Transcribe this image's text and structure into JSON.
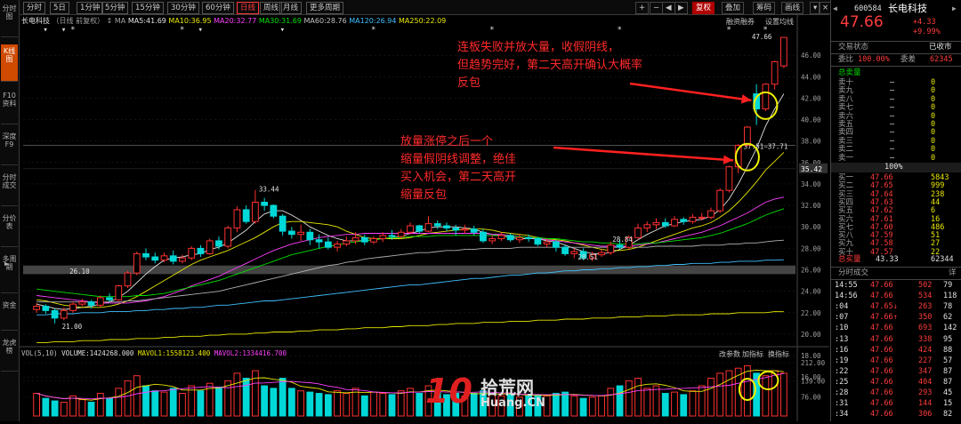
{
  "left_toolbar": [
    {
      "label": "分时图"
    },
    {
      "label": "K线图"
    },
    {
      "label": "F10资料"
    },
    {
      "label": "深度F9"
    },
    {
      "label": "分时成交"
    },
    {
      "label": "分价表"
    },
    {
      "label": "多周期"
    },
    {
      "label": "资金"
    },
    {
      "label": "龙虎榜"
    }
  ],
  "period_tabs": [
    "分时",
    "5日",
    "1分钟",
    "5分钟",
    "15分钟",
    "30分钟",
    "60分钟",
    "日线",
    "周线",
    "月线",
    "更多周期"
  ],
  "active_period": "日线",
  "toolbar_right": {
    "plus": "+",
    "minus": "−",
    "left": "◀",
    "right": "▶",
    "fq": "复权",
    "stack": "叠加",
    "chip": "筹码",
    "draw": "画线",
    "close": "×",
    "dropdown": "▾"
  },
  "chart_header": {
    "stock_name": "长电科技",
    "mode": "（日线 前复权）",
    "arrows": "↕",
    "ma_label": "MA",
    "ma5": "MA5:41.69",
    "ma10": "MA10:36.95",
    "ma20": "MA20:32.77",
    "ma30": "MA30:31.69",
    "ma60": "MA60:28.76",
    "ma120": "MA120:26.94",
    "ma250": "MA250:22.09",
    "fusion": "融资融券",
    "settings": "设置均线"
  },
  "annotations": {
    "note1": [
      "连板失败并放大量，收假阴线，",
      "但趋势完好，第二天高开确认大概率",
      "反包"
    ],
    "note2": [
      "放量涨停之后一个",
      "缩量假阴线调整，绝佳",
      "买入机会，第二天高开",
      "缩量反包"
    ]
  },
  "price_labels": {
    "high": "47.66",
    "p3344": "33.44",
    "p2100": "21.00",
    "p2851": "28.51",
    "p2610": "26.10",
    "range": "37.51−37.71",
    "p2884": "28.84"
  },
  "volume_header": {
    "vol": "VOL(5,10)",
    "volume": "VOLUME:1424268.000",
    "mavol1": "MAVOL1:1558123.400",
    "mavol2": "MAVOL2:1334416.700",
    "tabs": [
      "改参数",
      "加指标",
      "换指标"
    ]
  },
  "y_axis": [
    "46.00",
    "44.00",
    "42.00",
    "40.00",
    "38.00",
    "36.00",
    "35.42",
    "34.00",
    "32.00",
    "30.00",
    "28.00",
    "26.00",
    "24.00",
    "22.00",
    "20.00",
    "18.00",
    "16.00"
  ],
  "vol_axis": [
    "212.00",
    "139.00",
    "76.00"
  ],
  "watermark": {
    "ten": "10",
    "brand": "拾荒网",
    "url": "Huang.CN"
  },
  "quote": {
    "code": "600584",
    "name": "长电科技",
    "price": "47.66",
    "change": "+4.33",
    "pct": "+9.99%",
    "status_label": "交易状态",
    "status": "已收市",
    "weibi_label": "委比",
    "weibi": "100.00%",
    "weicha_label": "委差",
    "weicha": "62345",
    "sell_total_label": "总卖量",
    "sells": [
      {
        "l": "卖十",
        "p": "—",
        "v": "0"
      },
      {
        "l": "卖九",
        "p": "—",
        "v": "0"
      },
      {
        "l": "卖八",
        "p": "—",
        "v": "0"
      },
      {
        "l": "卖七",
        "p": "—",
        "v": "0"
      },
      {
        "l": "卖六",
        "p": "—",
        "v": "0"
      },
      {
        "l": "卖五",
        "p": "—",
        "v": "0"
      },
      {
        "l": "卖四",
        "p": "—",
        "v": "0"
      },
      {
        "l": "卖三",
        "p": "—",
        "v": "0"
      },
      {
        "l": "卖二",
        "p": "—",
        "v": "0"
      },
      {
        "l": "卖一",
        "p": "—",
        "v": "0"
      }
    ],
    "ratio": "100%",
    "buys": [
      {
        "l": "买一",
        "p": "47.66",
        "v": "5843"
      },
      {
        "l": "买二",
        "p": "47.65",
        "v": "999"
      },
      {
        "l": "买三",
        "p": "47.64",
        "v": "238"
      },
      {
        "l": "买四",
        "p": "47.63",
        "v": "44"
      },
      {
        "l": "买五",
        "p": "47.62",
        "v": "6"
      },
      {
        "l": "买六",
        "p": "47.61",
        "v": "16"
      },
      {
        "l": "买七",
        "p": "47.60",
        "v": "486"
      },
      {
        "l": "买八",
        "p": "47.59",
        "v": "51"
      },
      {
        "l": "买九",
        "p": "47.58",
        "v": "27"
      },
      {
        "l": "买十",
        "p": "47.57",
        "v": "22"
      }
    ],
    "buy_total_label": "总买量",
    "buy_total_avg": "43.33",
    "buy_total": "62344"
  },
  "trades": {
    "title": "分时成交",
    "detail": "详",
    "rows": [
      {
        "t": "14:55",
        "p": "47.66",
        "v": "502",
        "n": "79"
      },
      {
        "t": "14:56",
        "p": "47.66",
        "v": "534",
        "n": "118"
      },
      {
        "t": ":04",
        "p": "47.65↓",
        "v": "263",
        "n": "78"
      },
      {
        "t": ":07",
        "p": "47.66↑",
        "v": "350",
        "n": "62"
      },
      {
        "t": ":10",
        "p": "47.66",
        "v": "693",
        "n": "142"
      },
      {
        "t": ":13",
        "p": "47.66",
        "v": "338",
        "n": "95"
      },
      {
        "t": ":16",
        "p": "47.66",
        "v": "424",
        "n": "88"
      },
      {
        "t": ":19",
        "p": "47.66",
        "v": "227",
        "n": "57"
      },
      {
        "t": ":22",
        "p": "47.66",
        "v": "347",
        "n": "87"
      },
      {
        "t": ":25",
        "p": "47.66",
        "v": "404",
        "n": "87"
      },
      {
        "t": ":28",
        "p": "47.66",
        "v": "293",
        "n": "45"
      },
      {
        "t": ":31",
        "p": "47.66",
        "v": "144",
        "n": "15"
      },
      {
        "t": ":34",
        "p": "47.66",
        "v": "306",
        "n": "82"
      }
    ]
  },
  "chart_data": {
    "type": "candlestick",
    "ylim": [
      19,
      48
    ],
    "candles": [
      [
        22.3,
        22.6,
        22.0,
        22.9
      ],
      [
        22.6,
        22.2,
        21.9,
        22.8
      ],
      [
        22.2,
        21.5,
        21.0,
        22.4
      ],
      [
        21.5,
        22.2,
        21.3,
        22.5
      ],
      [
        22.2,
        22.8,
        22.0,
        23.0
      ],
      [
        22.8,
        23.0,
        22.6,
        23.3
      ],
      [
        23.0,
        22.7,
        22.4,
        23.2
      ],
      [
        22.7,
        23.4,
        22.5,
        23.6
      ],
      [
        23.4,
        23.2,
        23.0,
        23.8
      ],
      [
        23.2,
        24.5,
        23.1,
        24.6
      ],
      [
        24.5,
        25.7,
        24.3,
        25.9
      ],
      [
        25.7,
        27.5,
        25.5,
        27.7
      ],
      [
        27.5,
        27.2,
        26.9,
        28.0
      ],
      [
        27.2,
        26.9,
        26.6,
        27.6
      ],
      [
        26.9,
        27.3,
        26.7,
        27.6
      ],
      [
        27.3,
        26.8,
        26.5,
        27.8
      ],
      [
        26.8,
        27.1,
        26.6,
        27.4
      ],
      [
        27.1,
        28.0,
        26.9,
        28.2
      ],
      [
        28.0,
        27.5,
        27.2,
        28.3
      ],
      [
        27.5,
        28.7,
        27.4,
        28.9
      ],
      [
        28.7,
        28.2,
        27.9,
        29.1
      ],
      [
        28.2,
        29.9,
        28.0,
        30.1
      ],
      [
        29.9,
        31.6,
        29.5,
        31.9
      ],
      [
        31.6,
        30.5,
        30.3,
        32.0
      ],
      [
        30.5,
        32.3,
        30.3,
        33.44
      ],
      [
        32.3,
        32.0,
        31.5,
        32.7
      ],
      [
        32.0,
        31.0,
        30.8,
        32.1
      ],
      [
        31.0,
        29.6,
        29.2,
        31.2
      ],
      [
        29.6,
        29.3,
        28.9,
        30.0
      ],
      [
        29.3,
        29.5,
        28.7,
        30.2
      ],
      [
        29.5,
        28.8,
        28.3,
        29.8
      ],
      [
        28.8,
        28.6,
        28.0,
        29.3
      ],
      [
        28.6,
        28.1,
        27.9,
        29.0
      ],
      [
        28.1,
        28.4,
        27.7,
        28.7
      ],
      [
        28.4,
        28.7,
        28.2,
        29.1
      ],
      [
        28.7,
        29.0,
        28.4,
        29.5
      ],
      [
        29.0,
        28.6,
        28.3,
        29.3
      ],
      [
        28.6,
        28.9,
        28.4,
        29.1
      ],
      [
        28.9,
        29.2,
        28.6,
        29.5
      ],
      [
        29.2,
        29.1,
        28.8,
        29.7
      ],
      [
        29.1,
        29.5,
        28.9,
        29.8
      ],
      [
        29.5,
        30.1,
        29.3,
        30.4
      ],
      [
        30.1,
        29.6,
        29.4,
        30.2
      ],
      [
        29.6,
        30.3,
        29.5,
        31.0
      ],
      [
        30.3,
        30.1,
        29.8,
        30.6
      ],
      [
        30.1,
        29.9,
        29.6,
        30.4
      ],
      [
        29.9,
        29.7,
        29.2,
        30.2
      ],
      [
        29.7,
        29.8,
        29.4,
        30.2
      ],
      [
        29.8,
        29.5,
        29.2,
        30.1
      ],
      [
        29.5,
        28.7,
        28.5,
        29.8
      ],
      [
        28.7,
        28.9,
        28.4,
        29.2
      ],
      [
        28.9,
        29.2,
        28.7,
        29.5
      ],
      [
        29.2,
        28.8,
        28.6,
        29.4
      ],
      [
        28.8,
        29.0,
        28.5,
        29.3
      ],
      [
        29.0,
        28.9,
        28.6,
        29.3
      ],
      [
        28.9,
        28.4,
        28.2,
        29.1
      ],
      [
        28.4,
        28.6,
        28.1,
        28.9
      ],
      [
        28.6,
        28.1,
        27.7,
        28.8
      ],
      [
        28.1,
        27.5,
        27.3,
        28.3
      ],
      [
        27.5,
        27.7,
        27.1,
        28.0
      ],
      [
        27.7,
        27.1,
        26.9,
        28.0
      ],
      [
        27.1,
        27.4,
        26.8,
        27.7
      ],
      [
        27.4,
        27.6,
        27.2,
        27.9
      ],
      [
        27.6,
        28.3,
        27.4,
        28.6
      ],
      [
        28.3,
        28.1,
        27.9,
        28.84
      ],
      [
        28.1,
        29.0,
        27.9,
        29.2
      ],
      [
        29.0,
        29.9,
        28.9,
        30.3
      ],
      [
        29.9,
        30.2,
        29.5,
        30.5
      ],
      [
        30.2,
        30.4,
        29.8,
        30.8
      ],
      [
        30.4,
        30.1,
        29.9,
        30.8
      ],
      [
        30.1,
        30.7,
        30.0,
        31.0
      ],
      [
        30.7,
        30.5,
        30.2,
        30.9
      ],
      [
        30.5,
        30.9,
        30.3,
        31.2
      ],
      [
        30.9,
        30.9,
        30.6,
        31.3
      ],
      [
        30.9,
        31.5,
        30.7,
        31.8
      ],
      [
        31.5,
        33.4,
        31.3,
        33.6
      ],
      [
        33.4,
        35.6,
        33.2,
        35.7
      ],
      [
        35.6,
        37.6,
        35.0,
        37.71
      ],
      [
        37.6,
        39.3,
        37.5,
        39.4
      ],
      [
        42.4,
        41.0,
        39.5,
        43.3
      ],
      [
        41.0,
        43.3,
        40.8,
        43.4
      ],
      [
        43.3,
        45.4,
        42.8,
        45.5
      ],
      [
        45.0,
        47.66,
        44.8,
        47.66
      ]
    ],
    "volumes": [
      90,
      70,
      60,
      55,
      80,
      65,
      55,
      90,
      70,
      110,
      140,
      160,
      120,
      100,
      95,
      110,
      90,
      120,
      100,
      130,
      115,
      140,
      170,
      150,
      180,
      120,
      110,
      150,
      110,
      100,
      95,
      90,
      85,
      100,
      90,
      110,
      80,
      95,
      90,
      85,
      100,
      110,
      90,
      120,
      95,
      85,
      90,
      80,
      90,
      100,
      85,
      80,
      90,
      75,
      80,
      85,
      80,
      90,
      95,
      80,
      70,
      75,
      80,
      110,
      120,
      140,
      150,
      110,
      120,
      90,
      95,
      85,
      100,
      120,
      150,
      170,
      180,
      190,
      200,
      170,
      160,
      180,
      170
    ],
    "ma5": [
      22.8,
      22.6,
      22.4,
      22.3,
      22.4,
      22.5,
      22.6,
      22.8,
      23.0,
      23.4,
      24.0,
      24.8,
      25.6,
      26.3,
      26.9,
      27.1,
      27.2,
      27.4,
      27.5,
      27.9,
      28.1,
      28.5,
      29.1,
      29.7,
      30.5,
      31.2,
      31.5,
      31.5,
      31.1,
      30.6,
      30.0,
      29.6,
      29.2,
      28.9,
      28.7,
      28.7,
      28.7,
      28.8,
      28.9,
      29.0,
      29.1,
      29.4,
      29.6,
      29.9,
      30.0,
      30.0,
      30.0,
      29.9,
      29.8,
      29.5,
      29.3,
      29.2,
      29.0,
      28.9,
      28.9,
      28.9,
      28.7,
      28.6,
      28.3,
      28.0,
      27.7,
      27.5,
      27.5,
      27.6,
      27.9,
      28.3,
      28.8,
      29.3,
      29.7,
      30.1,
      30.3,
      30.5,
      30.6,
      30.7,
      31.0,
      31.6,
      32.6,
      34.0,
      35.6,
      37.3,
      39.4,
      41.0,
      42.4
    ],
    "ma10": [
      23.2,
      23.1,
      22.9,
      22.7,
      22.6,
      22.5,
      22.5,
      22.5,
      22.6,
      22.8,
      23.1,
      23.5,
      24.0,
      24.5,
      25.0,
      25.5,
      26.0,
      26.5,
      26.9,
      27.2,
      27.5,
      27.8,
      28.2,
      28.6,
      29.0,
      29.5,
      30.0,
      30.4,
      30.5,
      30.5,
      30.4,
      30.3,
      30.2,
      30.0,
      29.6,
      29.3,
      29.0,
      28.9,
      28.9,
      28.9,
      28.9,
      29.0,
      29.2,
      29.4,
      29.5,
      29.6,
      29.7,
      29.8,
      29.8,
      29.8,
      29.7,
      29.5,
      29.4,
      29.3,
      29.2,
      29.0,
      28.9,
      28.8,
      28.7,
      28.5,
      28.3,
      28.1,
      27.9,
      27.8,
      27.8,
      27.9,
      28.1,
      28.4,
      28.7,
      29.0,
      29.3,
      29.6,
      29.9,
      30.1,
      30.4,
      30.9,
      31.5,
      32.3,
      33.2,
      34.2,
      35.3,
      36.1,
      36.95
    ],
    "ma20": [
      23.6,
      23.5,
      23.4,
      23.3,
      23.2,
      23.1,
      23.0,
      22.9,
      22.9,
      22.9,
      22.9,
      23.0,
      23.1,
      23.3,
      23.5,
      23.8,
      24.1,
      24.5,
      24.8,
      25.1,
      25.4,
      25.8,
      26.2,
      26.6,
      27.0,
      27.4,
      27.8,
      28.1,
      28.4,
      28.6,
      28.8,
      29.0,
      29.1,
      29.2,
      29.3,
      29.3,
      29.4,
      29.4,
      29.4,
      29.4,
      29.4,
      29.4,
      29.4,
      29.4,
      29.4,
      29.4,
      29.4,
      29.4,
      29.4,
      29.4,
      29.3,
      29.3,
      29.2,
      29.1,
      29.0,
      28.9,
      28.8,
      28.7,
      28.6,
      28.5,
      28.4,
      28.3,
      28.2,
      28.2,
      28.2,
      28.2,
      28.3,
      28.4,
      28.5,
      28.7,
      28.9,
      29.1,
      29.3,
      29.5,
      29.8,
      30.1,
      30.5,
      30.9,
      31.3,
      31.8,
      32.3,
      32.6,
      32.77
    ],
    "ma30": [
      24.2,
      24.1,
      24.0,
      23.9,
      23.8,
      23.7,
      23.6,
      23.5,
      23.5,
      23.5,
      23.5,
      23.6,
      23.6,
      23.7,
      23.8,
      24.0,
      24.2,
      24.4,
      24.6,
      24.8,
      25.0,
      25.3,
      25.6,
      25.9,
      26.2,
      26.5,
      26.8,
      27.1,
      27.4,
      27.6,
      27.8,
      28.0,
      28.2,
      28.3,
      28.5,
      28.6,
      28.7,
      28.8,
      28.9,
      29.0,
      29.0,
      29.1,
      29.1,
      29.1,
      29.2,
      29.2,
      29.2,
      29.2,
      29.2,
      29.2,
      29.2,
      29.2,
      29.1,
      29.1,
      29.0,
      29.0,
      28.9,
      28.9,
      28.8,
      28.7,
      28.6,
      28.6,
      28.5,
      28.5,
      28.4,
      28.4,
      28.4,
      28.5,
      28.5,
      28.6,
      28.7,
      28.8,
      28.9,
      29.0,
      29.2,
      29.4,
      29.7,
      30.0,
      30.3,
      30.7,
      31.1,
      31.4,
      31.69
    ],
    "ma60": [
      23.0,
      23.0,
      23.0,
      23.0,
      23.0,
      23.0,
      23.0,
      23.0,
      23.0,
      23.0,
      23.1,
      23.1,
      23.2,
      23.3,
      23.4,
      23.5,
      23.6,
      23.7,
      23.8,
      23.9,
      24.0,
      24.2,
      24.4,
      24.6,
      24.8,
      25.0,
      25.2,
      25.4,
      25.6,
      25.8,
      26.0,
      26.2,
      26.4,
      26.5,
      26.7,
      26.8,
      27.0,
      27.1,
      27.2,
      27.3,
      27.4,
      27.5,
      27.6,
      27.6,
      27.7,
      27.8,
      27.8,
      27.9,
      27.9,
      28.0,
      28.0,
      28.0,
      28.0,
      28.1,
      28.1,
      28.1,
      28.1,
      28.1,
      28.1,
      28.1,
      28.1,
      28.1,
      28.1,
      28.1,
      28.1,
      28.1,
      28.1,
      28.1,
      28.2,
      28.2,
      28.2,
      28.2,
      28.2,
      28.3,
      28.3,
      28.3,
      28.4,
      28.4,
      28.5,
      28.5,
      28.6,
      28.7,
      28.76
    ],
    "ma120": [
      21.8,
      21.8,
      21.9,
      21.9,
      21.9,
      22.0,
      22.0,
      22.0,
      22.1,
      22.1,
      22.1,
      22.2,
      22.2,
      22.3,
      22.3,
      22.4,
      22.4,
      22.5,
      22.5,
      22.6,
      22.7,
      22.7,
      22.8,
      22.9,
      23.0,
      23.1,
      23.1,
      23.2,
      23.3,
      23.4,
      23.5,
      23.6,
      23.7,
      23.8,
      23.9,
      24.0,
      24.1,
      24.2,
      24.3,
      24.4,
      24.5,
      24.6,
      24.6,
      24.7,
      24.8,
      24.9,
      25.0,
      25.1,
      25.2,
      25.2,
      25.3,
      25.4,
      25.5,
      25.5,
      25.6,
      25.7,
      25.7,
      25.8,
      25.9,
      25.9,
      26.0,
      26.0,
      26.1,
      26.1,
      26.2,
      26.2,
      26.3,
      26.3,
      26.4,
      26.4,
      26.5,
      26.5,
      26.6,
      26.6,
      26.6,
      26.7,
      26.7,
      26.8,
      26.8,
      26.8,
      26.9,
      26.9,
      26.94
    ],
    "ma250": [
      19.2,
      19.2,
      19.3,
      19.3,
      19.3,
      19.4,
      19.4,
      19.4,
      19.5,
      19.5,
      19.5,
      19.6,
      19.6,
      19.6,
      19.7,
      19.7,
      19.8,
      19.8,
      19.8,
      19.9,
      19.9,
      20.0,
      20.0,
      20.0,
      20.1,
      20.1,
      20.2,
      20.2,
      20.2,
      20.3,
      20.3,
      20.4,
      20.4,
      20.4,
      20.5,
      20.5,
      20.6,
      20.6,
      20.6,
      20.7,
      20.7,
      20.8,
      20.8,
      20.8,
      20.9,
      20.9,
      21.0,
      21.0,
      21.0,
      21.1,
      21.1,
      21.1,
      21.2,
      21.2,
      21.2,
      21.3,
      21.3,
      21.3,
      21.4,
      21.4,
      21.4,
      21.5,
      21.5,
      21.5,
      21.6,
      21.6,
      21.6,
      21.7,
      21.7,
      21.7,
      21.8,
      21.8,
      21.8,
      21.8,
      21.9,
      21.9,
      21.9,
      22.0,
      22.0,
      22.0,
      22.0,
      22.1,
      22.09
    ]
  }
}
